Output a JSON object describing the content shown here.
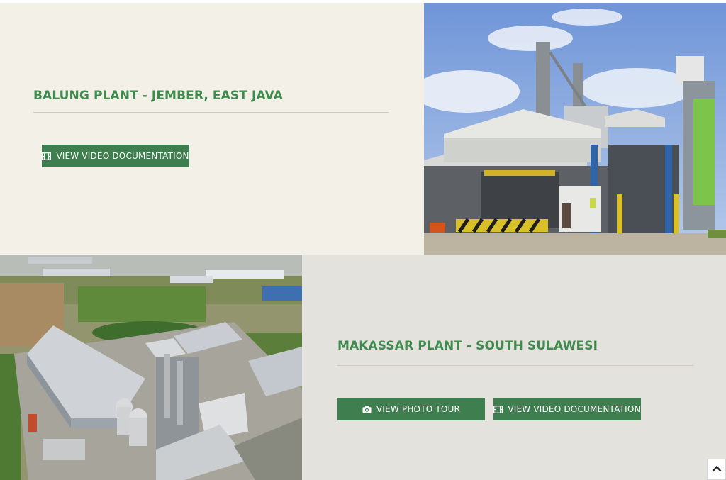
{
  "plants": [
    {
      "title": "BALUNG PLANT - JEMBER, EAST JAVA",
      "buttons": [
        {
          "label": "VIEW VIDEO DOCUMENTATION",
          "icon": "film-icon"
        }
      ],
      "photo": "sugar-mill-exterior"
    },
    {
      "title": "MAKASSAR PLANT - SOUTH SULAWESI",
      "buttons": [
        {
          "label": "VIEW PHOTO TOUR",
          "icon": "camera-icon"
        },
        {
          "label": "VIEW VIDEO DOCUMENTATION",
          "icon": "film-icon"
        }
      ],
      "photo": "aerial-plant-view"
    }
  ],
  "scroll_top": {
    "icon": "chevron-up-icon"
  },
  "colors": {
    "title_green": "#3f8a4d",
    "button_green": "#3f7f4f",
    "panel_light": "#f3f0e8",
    "panel_grey": "#e4e2dd"
  }
}
